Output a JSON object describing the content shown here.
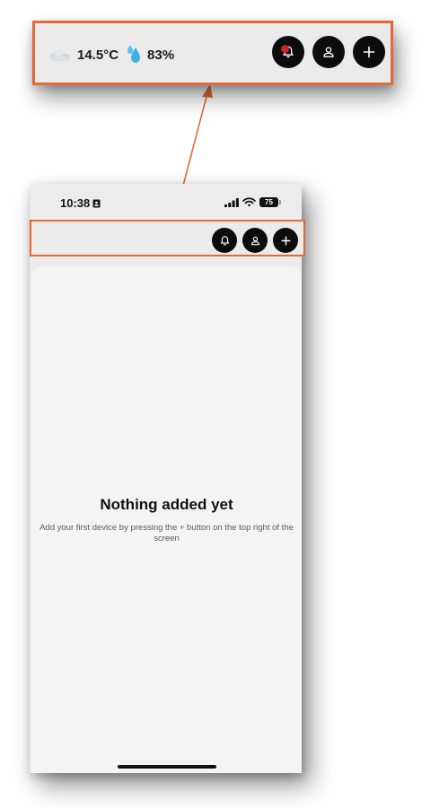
{
  "zoom_header": {
    "temperature": "14.5°C",
    "humidity": "83%",
    "weather_icon": "cloud-icon",
    "humidity_icon": "water-drop-icon"
  },
  "status_bar": {
    "time": "10:38",
    "battery": "75"
  },
  "header": {
    "buttons": [
      "bell-icon",
      "user-icon",
      "plus-icon"
    ]
  },
  "empty_state": {
    "title": "Nothing added yet",
    "subtitle": "Add your first device by pressing the + button on the top right of the screen"
  },
  "colors": {
    "callout_border": "#e4693a",
    "button_bg": "#0c0c0c",
    "notification_dot": "#c3272b",
    "humidity_drop": "#3fb0e6"
  }
}
